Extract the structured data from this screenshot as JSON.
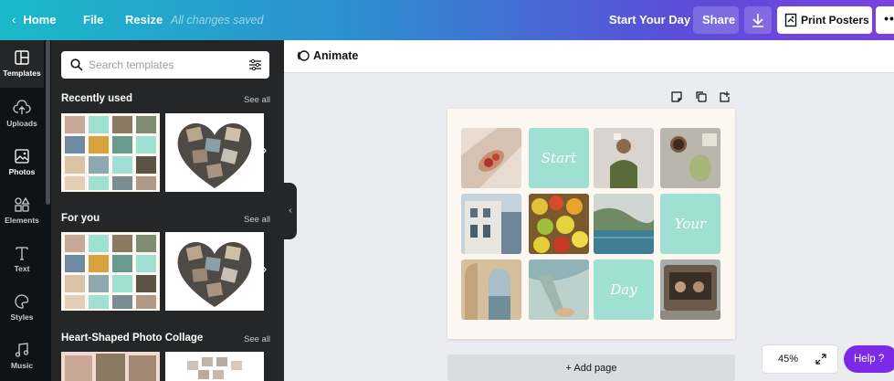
{
  "topbar": {
    "home": "Home",
    "file": "File",
    "resize": "Resize",
    "saved_status": "All changes saved",
    "title": "Start Your Day",
    "share": "Share",
    "print": "Print Posters",
    "more": "••"
  },
  "rail": [
    {
      "label": "Templates",
      "icon": "templates-icon"
    },
    {
      "label": "Uploads",
      "icon": "upload-cloud-icon"
    },
    {
      "label": "Photos",
      "icon": "photo-icon"
    },
    {
      "label": "Elements",
      "icon": "elements-icon"
    },
    {
      "label": "Text",
      "icon": "text-icon"
    },
    {
      "label": "Styles",
      "icon": "palette-icon"
    },
    {
      "label": "Music",
      "icon": "music-icon"
    }
  ],
  "panel": {
    "search_placeholder": "Search templates",
    "sections": [
      {
        "title": "Recently used",
        "see_all": "See all"
      },
      {
        "title": "For you",
        "see_all": "See all"
      },
      {
        "title": "Heart-Shaped Photo Collage",
        "see_all": "See all"
      }
    ]
  },
  "editor": {
    "animate": "Animate",
    "design_words": [
      "Start",
      "Your",
      "Day"
    ],
    "add_page": "+ Add page",
    "zoom": "45%",
    "help": "Help ?"
  },
  "colors": {
    "mint": "#9fe0d2",
    "rail": "#0e1318",
    "panel": "#252627",
    "help": "#7d2ae8"
  }
}
